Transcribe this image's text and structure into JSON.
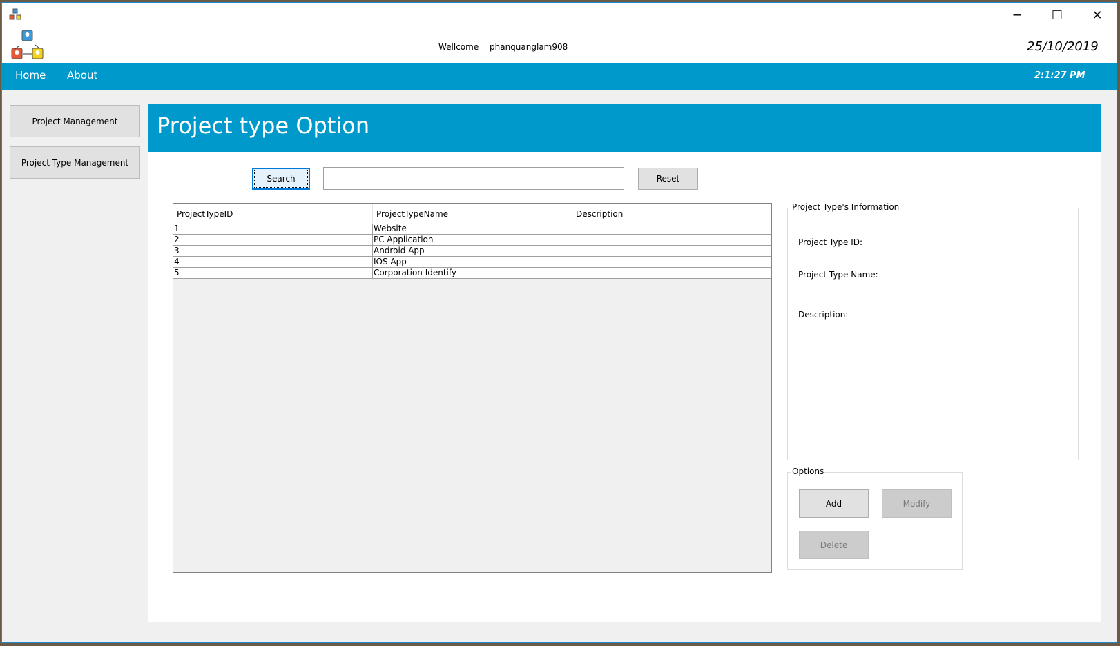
{
  "window": {
    "controls": {
      "minimize": "─",
      "maximize": "☐",
      "close": "✕"
    }
  },
  "header": {
    "welcome_label": "Wellcome",
    "username": "phanquanglam908",
    "date": "25/10/2019",
    "time": "2:1:27 PM"
  },
  "nav": {
    "items": [
      {
        "label": "Home"
      },
      {
        "label": "About"
      }
    ]
  },
  "sidebar": {
    "items": [
      {
        "label": "Project Management"
      },
      {
        "label": "Project Type Management"
      }
    ]
  },
  "main": {
    "title": "Project type Option",
    "search_button": "Search",
    "search_value": "",
    "reset_button": "Reset",
    "table": {
      "columns": [
        "ProjectTypeID",
        "ProjectTypeName",
        "Description"
      ],
      "rows": [
        [
          "1",
          "Website",
          ""
        ],
        [
          "2",
          "PC Application",
          ""
        ],
        [
          "3",
          "Android App",
          ""
        ],
        [
          "4",
          "IOS App",
          ""
        ],
        [
          "5",
          "Corporation Identify",
          ""
        ]
      ]
    },
    "info": {
      "caption": "Project Type's Information",
      "id_label": "Project Type ID:",
      "name_label": "Project Type Name:",
      "desc_label": "Description:"
    },
    "options": {
      "caption": "Options",
      "add": "Add",
      "modify": "Modify",
      "delete": "Delete"
    }
  },
  "colors": {
    "accent": "#0099cc"
  }
}
